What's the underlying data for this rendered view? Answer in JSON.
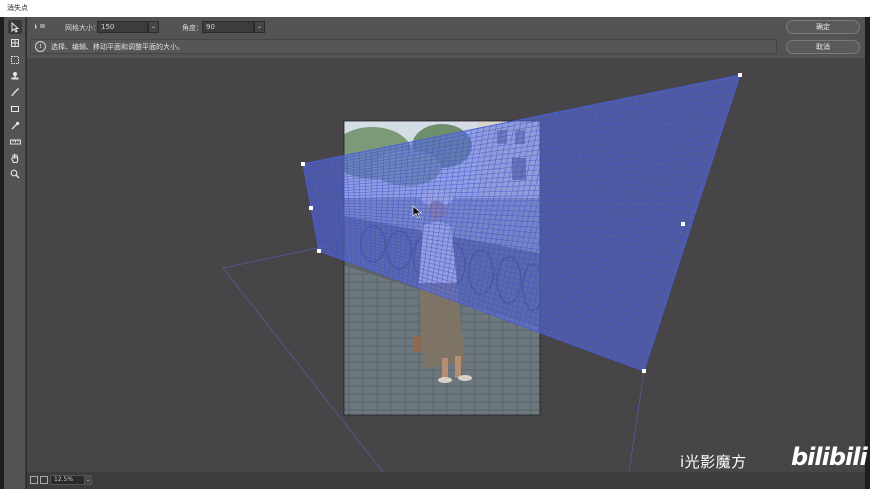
{
  "window": {
    "title": "消失点"
  },
  "options": {
    "grid_size_label": "网格大小：",
    "grid_size_value": "150",
    "angle_label": "角度：",
    "angle_value": "90",
    "info_text": "选择、编辑、移动平面和调整平面的大小。",
    "ok_label": "确定",
    "cancel_label": "取消"
  },
  "tools": [
    {
      "name": "edit-plane-tool-icon"
    },
    {
      "name": "create-plane-tool-icon"
    },
    {
      "name": "marquee-tool-icon"
    },
    {
      "name": "stamp-tool-icon"
    },
    {
      "name": "brush-tool-icon"
    },
    {
      "name": "transform-tool-icon"
    },
    {
      "name": "eyedropper-tool-icon"
    },
    {
      "name": "measure-tool-icon"
    },
    {
      "name": "hand-tool-icon"
    },
    {
      "name": "zoom-tool-icon"
    }
  ],
  "status": {
    "zoom": "12.5%"
  },
  "watermark": {
    "channel": "i光影魔方",
    "site": "bilibili"
  },
  "colors": {
    "grid": "#4a5ed8",
    "grid_fill": "#5a6ee8",
    "canvas": "#474547",
    "panel": "#535353"
  }
}
